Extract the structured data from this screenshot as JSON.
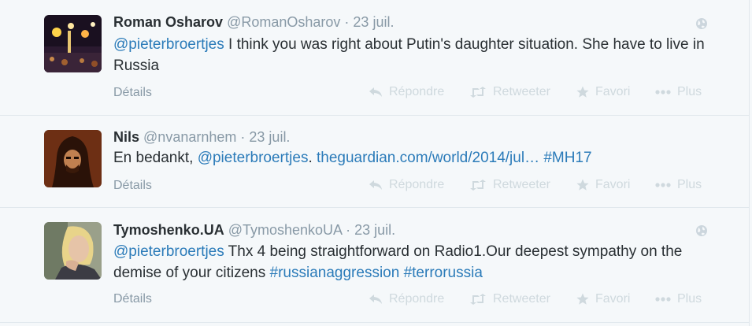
{
  "tweets": [
    {
      "fullname": "Roman Osharov",
      "username": "@RomanOsharov",
      "time": "23 juil.",
      "text_parts": [
        {
          "text": "@pieterbroertjes",
          "link": true
        },
        {
          "text": " I think you was right about Putin's daughter situation. She have to live in Russia",
          "link": false
        }
      ],
      "details_label": "Détails",
      "reply_label": "Répondre",
      "retweet_label": "Retweeter",
      "favorite_label": "Favori",
      "more_label": "Plus"
    },
    {
      "fullname": "Nils",
      "username": "@nvanarnhem",
      "time": "23 juil.",
      "text_parts": [
        {
          "text": "En bedankt, ",
          "link": false
        },
        {
          "text": "@pieterbroertjes",
          "link": true
        },
        {
          "text": ". ",
          "link": false
        },
        {
          "text": "theguardian.com/world/2014/jul…",
          "link": true
        },
        {
          "text": " ",
          "link": false
        },
        {
          "text": "#MH17",
          "link": true
        }
      ],
      "details_label": "Détails",
      "reply_label": "Répondre",
      "retweet_label": "Retweeter",
      "favorite_label": "Favori",
      "more_label": "Plus"
    },
    {
      "fullname": "Tymoshenko.UA",
      "username": "@TymoshenkoUA",
      "time": "23 juil.",
      "text_parts": [
        {
          "text": "@pieterbroertjes",
          "link": true
        },
        {
          "text": " Thx 4 being straightforward on Radio1.Our deepest sympathy on the demise of your citizens ",
          "link": false
        },
        {
          "text": "#russianaggression",
          "link": true
        },
        {
          "text": " ",
          "link": false
        },
        {
          "text": "#terrorussia",
          "link": true
        }
      ],
      "details_label": "Détails",
      "reply_label": "Répondre",
      "retweet_label": "Retweeter",
      "favorite_label": "Favori",
      "more_label": "Plus"
    }
  ],
  "colors": {
    "background": "#f5f8fa",
    "link": "#2b7bb9",
    "muted": "#8899a6",
    "action_muted": "#cfd9de",
    "text": "#292f33"
  },
  "icons": [
    "globe-icon",
    "reply-icon",
    "retweet-icon",
    "star-icon",
    "more-dots-icon"
  ]
}
